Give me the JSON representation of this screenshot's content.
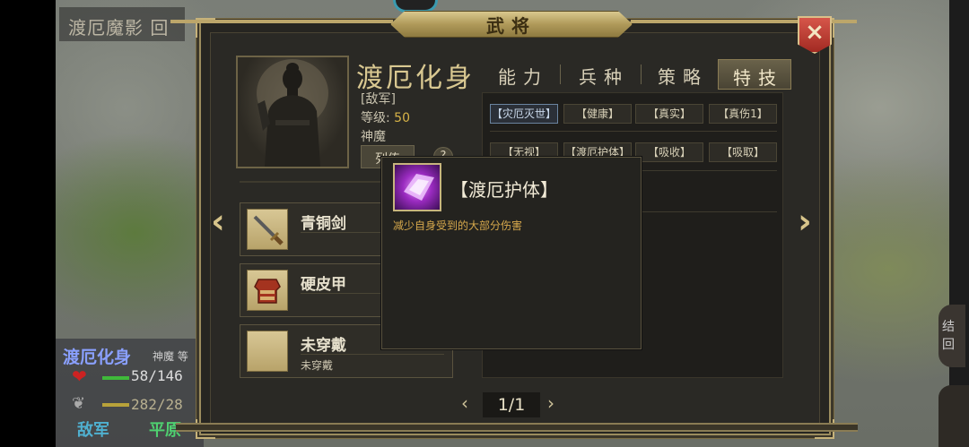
{
  "background": {
    "map_title": "渡厄魔影 回",
    "unit": {
      "name": "渡厄化身",
      "class": "神魔 等",
      "hp": "58/146",
      "mp": "282/28",
      "side": "敌军",
      "status": "平原"
    },
    "right_button": "结 回"
  },
  "dialog": {
    "title": "武将",
    "close_icon": "×",
    "general": {
      "name": "渡厄化身",
      "faction": "[敌军]",
      "level_label": "等级:",
      "level_value": "50",
      "class": "神魔",
      "bio_button": "列传",
      "help_button": "?"
    },
    "tabs": [
      {
        "label": "能力",
        "active": false
      },
      {
        "label": "兵种",
        "active": false
      },
      {
        "label": "策略",
        "active": false
      },
      {
        "label": "特技",
        "active": true
      }
    ],
    "skills_row1": [
      "【灾厄灭世】",
      "【健康】",
      "【真实】",
      "【真伤1】"
    ],
    "skills_row2": [
      "【无视】",
      "【渡厄护体】",
      "【吸收】",
      "【吸取】"
    ],
    "equipment": [
      {
        "name": "青铜剑",
        "sub": "",
        "icon": "sword-icon"
      },
      {
        "name": "硬皮甲",
        "sub": "",
        "icon": "armor-icon"
      },
      {
        "name": "未穿戴",
        "sub": "未穿戴",
        "icon": "empty-slot"
      }
    ],
    "nav": {
      "prev": "‹",
      "next": "›"
    },
    "pager": {
      "prev": "‹",
      "text": "1/1",
      "next": "›"
    }
  },
  "tooltip": {
    "title": "【渡厄护体】",
    "description": "减少自身受到的大部分伤害",
    "icon": "crystal-skill-icon"
  },
  "colors": {
    "gold": "#d9c891",
    "level": "#d7b347",
    "tooltip_desc": "#d6a84c",
    "close_red": "#c23a30"
  }
}
